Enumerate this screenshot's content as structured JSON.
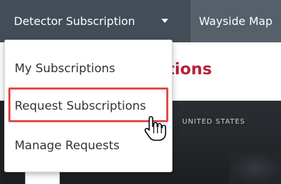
{
  "navbar": {
    "detector_label": "Detector Subscription",
    "wayside_label": "Wayside Map"
  },
  "page": {
    "title_fragment": "tions",
    "map_label": "UNITED STATES"
  },
  "dropdown": {
    "items": [
      {
        "label": "My Subscriptions"
      },
      {
        "label": "Request Subscriptions",
        "highlighted": true
      },
      {
        "label": "Manage Requests"
      }
    ]
  },
  "colors": {
    "navbar_bg": "#55606b",
    "navbar_active_bg": "#424d58",
    "title_red": "#b52238",
    "highlight_red": "#e5484d"
  },
  "icons": {
    "caret": "caret-down-icon",
    "cursor": "hand-pointer-icon"
  }
}
